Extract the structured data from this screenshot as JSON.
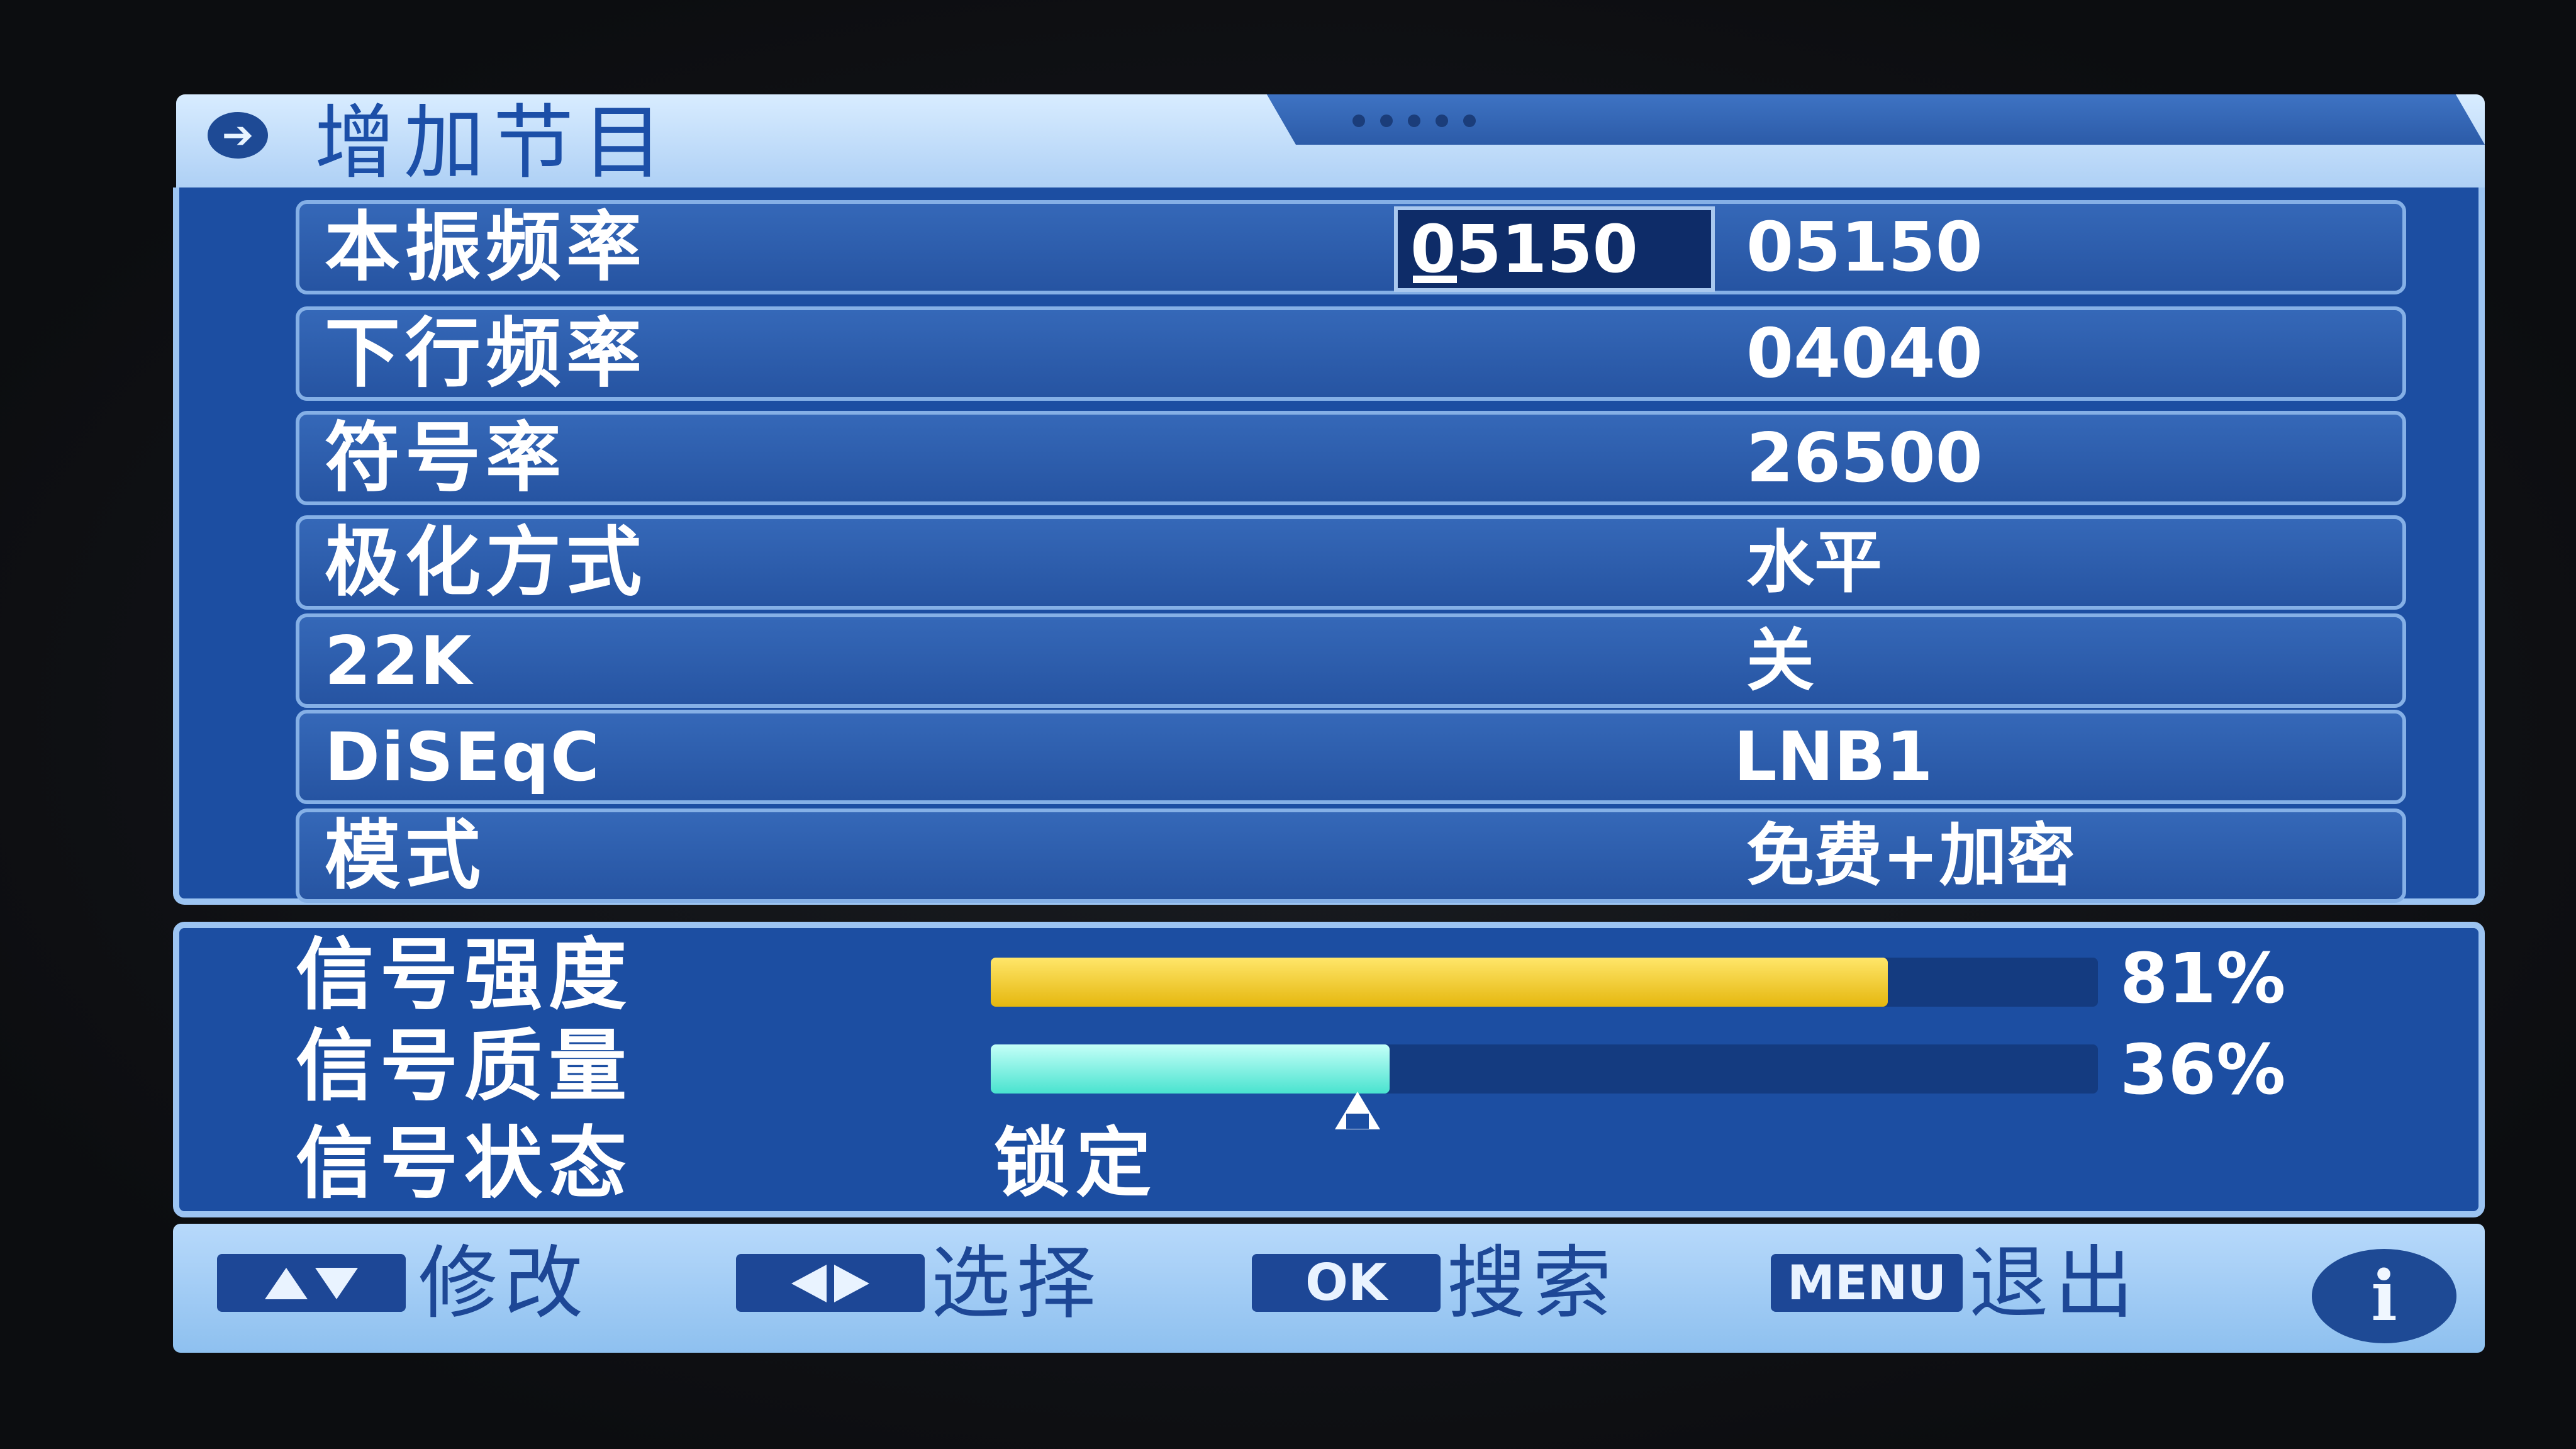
{
  "title": {
    "icon": "arrow-right-circle-icon",
    "text": "增加节目"
  },
  "rows": [
    {
      "label": "本振频率",
      "value": "05150",
      "edit_value": "05150"
    },
    {
      "label": "下行频率",
      "value": "04040"
    },
    {
      "label": "符号率",
      "value": "26500"
    },
    {
      "label": "极化方式",
      "value": "水平"
    },
    {
      "label": "22K",
      "value": "关"
    },
    {
      "label": "DiSEqC",
      "value": "LNB1"
    },
    {
      "label": "模式",
      "value": "免费+加密"
    }
  ],
  "signal": {
    "strength_label": "信号强度",
    "strength_percent": 81,
    "strength_text": "81%",
    "quality_label": "信号质量",
    "quality_percent": 36,
    "quality_text": "36%",
    "status_label": "信号状态",
    "status_value": "锁定"
  },
  "footer": {
    "modify": {
      "key_icon": "up-down-arrows-icon",
      "label": "修改"
    },
    "select": {
      "key_icon": "left-right-arrows-icon",
      "label": "选择"
    },
    "search": {
      "key": "OK",
      "label": "搜索"
    },
    "exit": {
      "key": "MENU",
      "label": "退出"
    },
    "info": {
      "key": "i",
      "icon": "info-icon"
    }
  },
  "colors": {
    "panel": "#1c4ea2",
    "strength_bar": "#f2c21c",
    "quality_bar": "#5ff0dc",
    "title_bar": "#c8e2fb"
  }
}
